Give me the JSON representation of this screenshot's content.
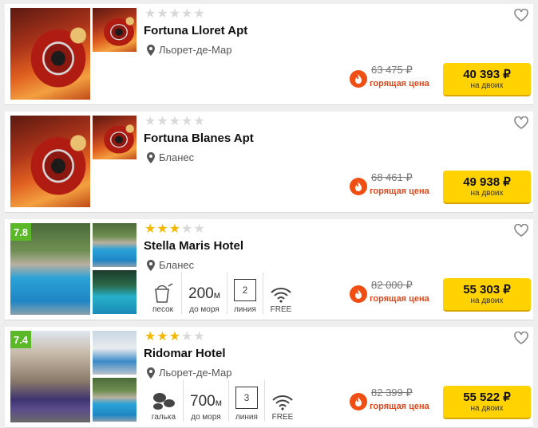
{
  "hotels": [
    {
      "name": "Fortuna Lloret Apt",
      "location": "Льорет-де-Мар",
      "stars": 0,
      "rating": "",
      "old_price": "63 475 ₽",
      "hot_label": "горящая цена",
      "price": "40 393 ₽",
      "per": "на двоих",
      "photos": "roulette"
    },
    {
      "name": "Fortuna Blanes Apt",
      "location": "Бланес",
      "stars": 0,
      "rating": "",
      "old_price": "68 461 ₽",
      "hot_label": "горящая цена",
      "price": "49 938 ₽",
      "per": "на двоих",
      "photos": "roulette"
    },
    {
      "name": "Stella Maris Hotel",
      "location": "Бланес",
      "stars": 3,
      "rating": "7.8",
      "features": {
        "beach_type": "песок",
        "distance_value": "200",
        "distance_unit": "м",
        "distance_label": "до моря",
        "line_value": "2",
        "line_label": "линия",
        "wifi_label": "FREE"
      },
      "old_price": "82 000 ₽",
      "hot_label": "горящая цена",
      "price": "55 303 ₽",
      "per": "на двоих",
      "photos": "pool"
    },
    {
      "name": "Ridomar Hotel",
      "location": "Льорет-де-Мар",
      "stars": 3,
      "rating": "7.4",
      "features": {
        "beach_type": "галька",
        "distance_value": "700",
        "distance_unit": "м",
        "distance_label": "до моря",
        "line_value": "3",
        "line_label": "линия",
        "wifi_label": "FREE"
      },
      "old_price": "82 399 ₽",
      "hot_label": "горящая цена",
      "price": "55 522 ₽",
      "per": "на двоих",
      "photos": "hotel"
    }
  ],
  "colors": {
    "accent_button": "#ffd200",
    "hot": "#e2471b",
    "rating_badge": "#5ab829",
    "star_on": "#f5b800",
    "star_off": "#d9d9d9"
  }
}
